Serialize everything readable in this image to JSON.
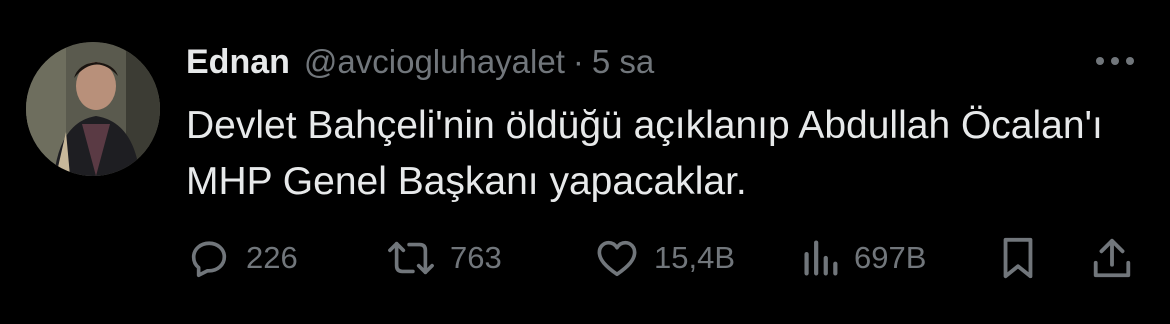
{
  "tweet": {
    "author_name": "Ednan",
    "author_handle": "@avciogluhayalet",
    "separator": "·",
    "time": "5 sa",
    "text": "Devlet Bahçeli'nin öldüğü açıklanıp Abdullah Öcalan'ı MHP Genel Başkanı yapacaklar.",
    "more_icon": "more-horizontal-icon",
    "avatar": "profile-photo"
  },
  "actions": {
    "reply_count": "226",
    "retweet_count": "763",
    "like_count": "15,4B",
    "views_count": "697B",
    "icons": [
      "reply-icon",
      "retweet-icon",
      "like-icon",
      "views-icon",
      "bookmark-icon",
      "share-icon"
    ]
  },
  "colors": {
    "background": "#000000",
    "primary_text": "#e7e9ea",
    "secondary_text": "#71767b"
  }
}
